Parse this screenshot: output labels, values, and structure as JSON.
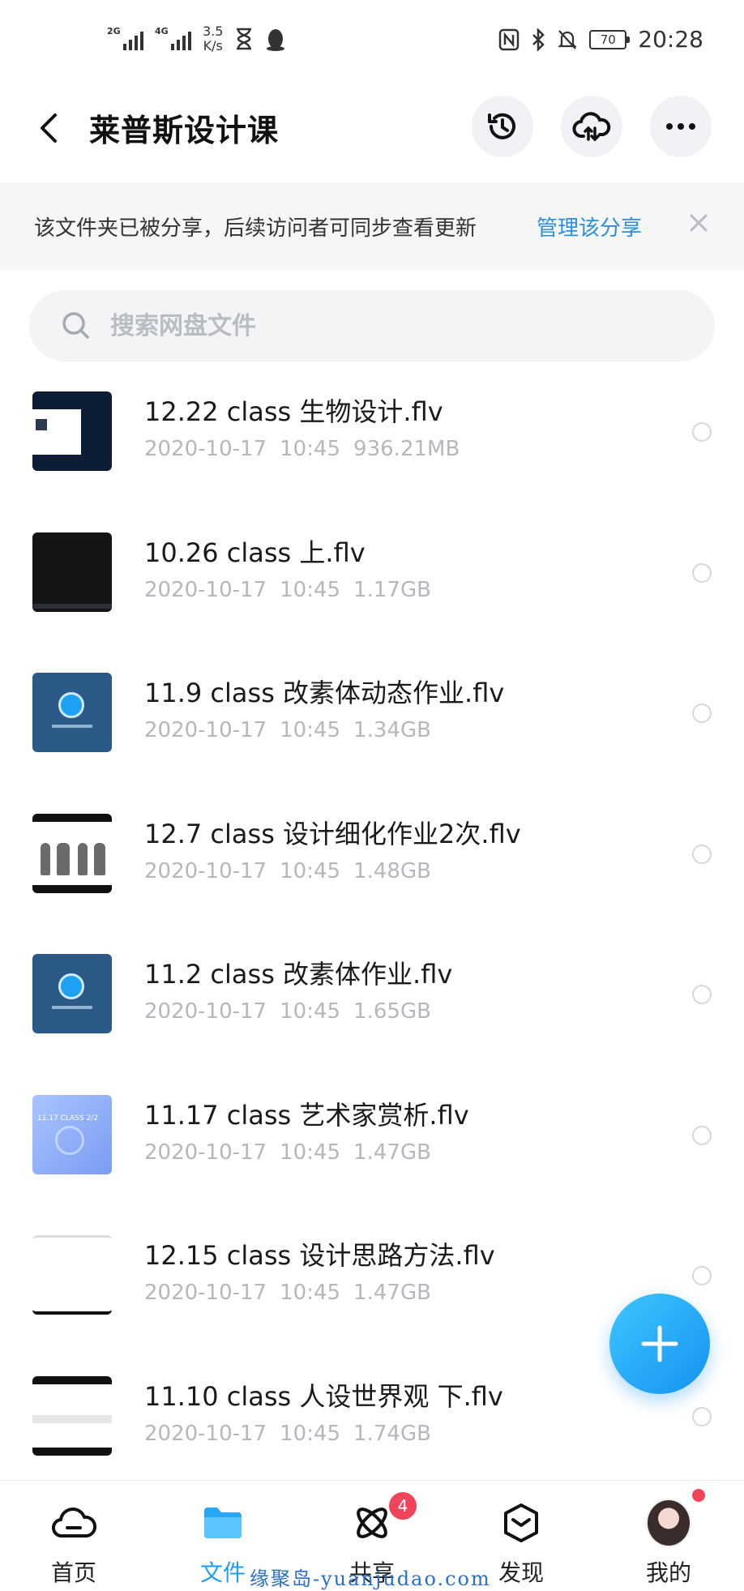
{
  "status_bar": {
    "signal1_label": "2G",
    "signal2_label": "4G",
    "speed_value": "3.5",
    "speed_unit": "K/s",
    "battery": "70",
    "time": "20:28"
  },
  "header": {
    "title": "莱普斯设计课",
    "icons": [
      "back-icon",
      "history-icon",
      "cloud-upload-icon",
      "more-icon"
    ]
  },
  "share_banner": {
    "text": "该文件夹已被分享，后续访问者可同步查看更新",
    "link": "管理该分享"
  },
  "search": {
    "placeholder": "搜索网盘文件"
  },
  "files": [
    {
      "name": "12.22 class 生物设计.flv",
      "date": "2020-10-17",
      "time": "10:45",
      "size": "936.21MB"
    },
    {
      "name": "10.26 class 上.flv",
      "date": "2020-10-17",
      "time": "10:45",
      "size": "1.17GB"
    },
    {
      "name": "11.9 class 改素体动态作业.flv",
      "date": "2020-10-17",
      "time": "10:45",
      "size": "1.34GB"
    },
    {
      "name": "12.7 class 设计细化作业2次.flv",
      "date": "2020-10-17",
      "time": "10:45",
      "size": "1.48GB"
    },
    {
      "name": "11.2 class 改素体作业.flv",
      "date": "2020-10-17",
      "time": "10:45",
      "size": "1.65GB"
    },
    {
      "name": "11.17 class 艺术家赏析.flv",
      "date": "2020-10-17",
      "time": "10:45",
      "size": "1.47GB"
    },
    {
      "name": "12.15 class 设计思路方法.flv",
      "date": "2020-10-17",
      "time": "10:45",
      "size": "1.47GB"
    },
    {
      "name": "11.10 class 人设世界观 下.flv",
      "date": "2020-10-17",
      "time": "10:45",
      "size": "1.74GB"
    }
  ],
  "thumb_texts": {
    "light": "11.17 CLASS 2/2"
  },
  "bottom_nav": [
    {
      "label": "首页",
      "icon": "cloud-icon"
    },
    {
      "label": "文件",
      "icon": "folder-icon",
      "active": true
    },
    {
      "label": "共享",
      "icon": "atom-icon",
      "badge": "4"
    },
    {
      "label": "发现",
      "icon": "discover-box-icon"
    },
    {
      "label": "我的",
      "icon": "avatar-icon",
      "dot": true
    }
  ],
  "watermark": "缘聚岛-yuanjudao.com",
  "colors": {
    "accent": "#1ea0f2",
    "link": "#2a8fe0",
    "badge": "#f0445a",
    "muted": "#b4b7bd"
  }
}
